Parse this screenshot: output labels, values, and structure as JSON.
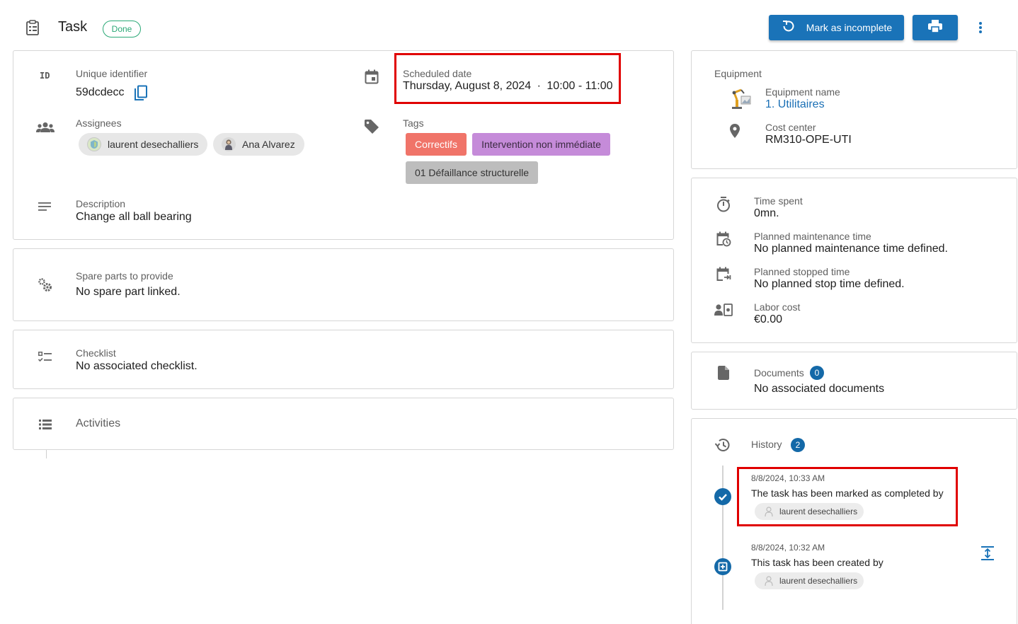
{
  "header": {
    "title": "Task",
    "status": "Done",
    "mark_incomplete_label": "Mark as incomplete"
  },
  "details": {
    "uid_label": "Unique identifier",
    "uid_value": "59dcdecc",
    "id_icon_text": "ID",
    "scheduled_label": "Scheduled date",
    "scheduled_date": "Thursday, August 8, 2024",
    "scheduled_sep": "·",
    "scheduled_time": "10:00 - 11:00",
    "assignees_label": "Assignees",
    "assignees": [
      "laurent desechalliers",
      "Ana Alvarez"
    ],
    "tags_label": "Tags",
    "tags": [
      {
        "label": "Correctifs",
        "color": "#f07469",
        "text_color": "#ffffff"
      },
      {
        "label": "Intervention non immédiate",
        "color": "#c58bd9",
        "text_color": "#3a2a40"
      },
      {
        "label": "01 Défaillance structurelle",
        "color": "#bdbdbd",
        "text_color": "#333333"
      }
    ],
    "description_label": "Description",
    "description_value": "Change all ball bearing"
  },
  "spare_parts": {
    "label": "Spare parts to provide",
    "value": "No spare part linked."
  },
  "checklist": {
    "label": "Checklist",
    "value": "No associated checklist."
  },
  "activities": {
    "label": "Activities"
  },
  "equipment": {
    "title": "Equipment",
    "name_label": "Equipment name",
    "name_value": "1. Utilitaires",
    "cost_center_label": "Cost center",
    "cost_center_value": "RM310-OPE-UTI"
  },
  "times": {
    "time_spent_label": "Time spent",
    "time_spent_value": "0mn.",
    "planned_maint_label": "Planned maintenance time",
    "planned_maint_value": "No planned maintenance time defined.",
    "planned_stop_label": "Planned stopped time",
    "planned_stop_value": "No planned stop time defined.",
    "labor_cost_label": "Labor cost",
    "labor_cost_value": "€0.00"
  },
  "documents": {
    "label": "Documents",
    "count": "0",
    "value": "No associated documents"
  },
  "history": {
    "label": "History",
    "count": "2",
    "events": [
      {
        "timestamp": "8/8/2024, 10:33 AM",
        "text": "The task has been marked as completed by",
        "user": "laurent desechalliers"
      },
      {
        "timestamp": "8/8/2024, 10:32 AM",
        "text": "This task has been created by",
        "user": "laurent desechalliers"
      }
    ]
  },
  "colors": {
    "accent": "#1a73b8",
    "done_badge": "#2aa876",
    "highlight": "#e00000",
    "link": "#1a6fb5"
  },
  "icons": [
    "clipboard-icon",
    "refresh-icon",
    "print-icon",
    "more-vert-icon",
    "id-icon",
    "copy-icon",
    "calendar-icon",
    "group-icon",
    "tag-icon",
    "notes-icon",
    "gears-icon",
    "checklist-icon",
    "list-icon",
    "equipment-image-icon",
    "location-pin-icon",
    "timer-icon",
    "calendar-clock-icon",
    "calendar-stop-icon",
    "labor-cost-icon",
    "document-icon",
    "history-icon",
    "check-circle-icon",
    "add-box-icon",
    "expand-vertical-icon"
  ]
}
